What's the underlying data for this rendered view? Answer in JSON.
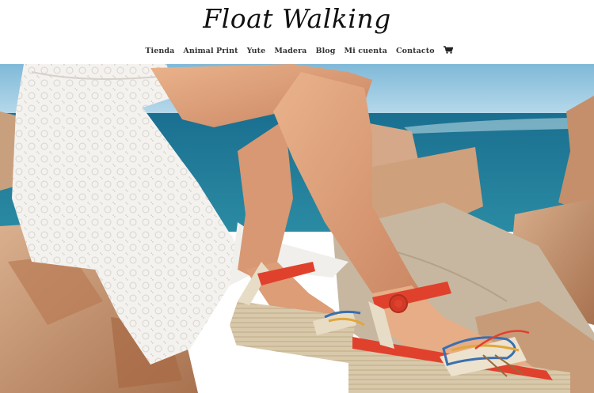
{
  "site": {
    "logo": "Float Walking"
  },
  "nav": {
    "items": [
      {
        "label": "Tienda"
      },
      {
        "label": "Animal Print"
      },
      {
        "label": "Yute"
      },
      {
        "label": "Madera"
      },
      {
        "label": "Blog"
      },
      {
        "label": "Mi cuenta"
      },
      {
        "label": "Contacto"
      }
    ],
    "cart_icon": "shopping-cart-icon"
  },
  "hero": {
    "image": "photo-woman-espadrille-wedge-sandals-on-rocks-by-sea",
    "colors": {
      "sky": "#8ec3dd",
      "sea": "#1f7d9a",
      "rock": "#c89a7a",
      "dress": "#f2f0ed",
      "skin": "#e2a781",
      "strap": "#e0412d",
      "jute": "#d8c8ab"
    }
  }
}
